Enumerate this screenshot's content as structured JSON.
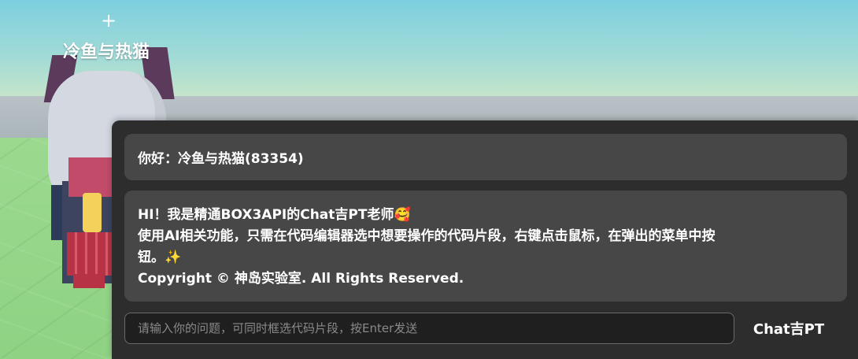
{
  "scene": {
    "crosshair_glyph": "+",
    "player_name": "冷鱼与热猫"
  },
  "chat": {
    "greeting": "你好：冷鱼与热猫(83354)",
    "intro": {
      "line1": "HI！我是精通BOX3API的Chat吉PT老师",
      "line1_emoji": "🥰",
      "line2": "使用AI相关功能，只需在代码编辑器选中想要操作的代码片段，右键点击鼠标，在弹出的菜单中按",
      "line3": "钮。",
      "line3_emoji": "✨",
      "line4": "Copyright © 神岛实验室. All Rights Reserved."
    },
    "input": {
      "value": "",
      "placeholder": "请输入你的问题，可同时框选代码片段，按Enter发送"
    },
    "send_label": "Chat吉PT"
  },
  "colors": {
    "panel_bg": "#2d2d2d",
    "bubble_bg": "#474747",
    "input_bg": "#1f1f1f",
    "text": "#ffffff",
    "placeholder": "#8a8a8a"
  }
}
